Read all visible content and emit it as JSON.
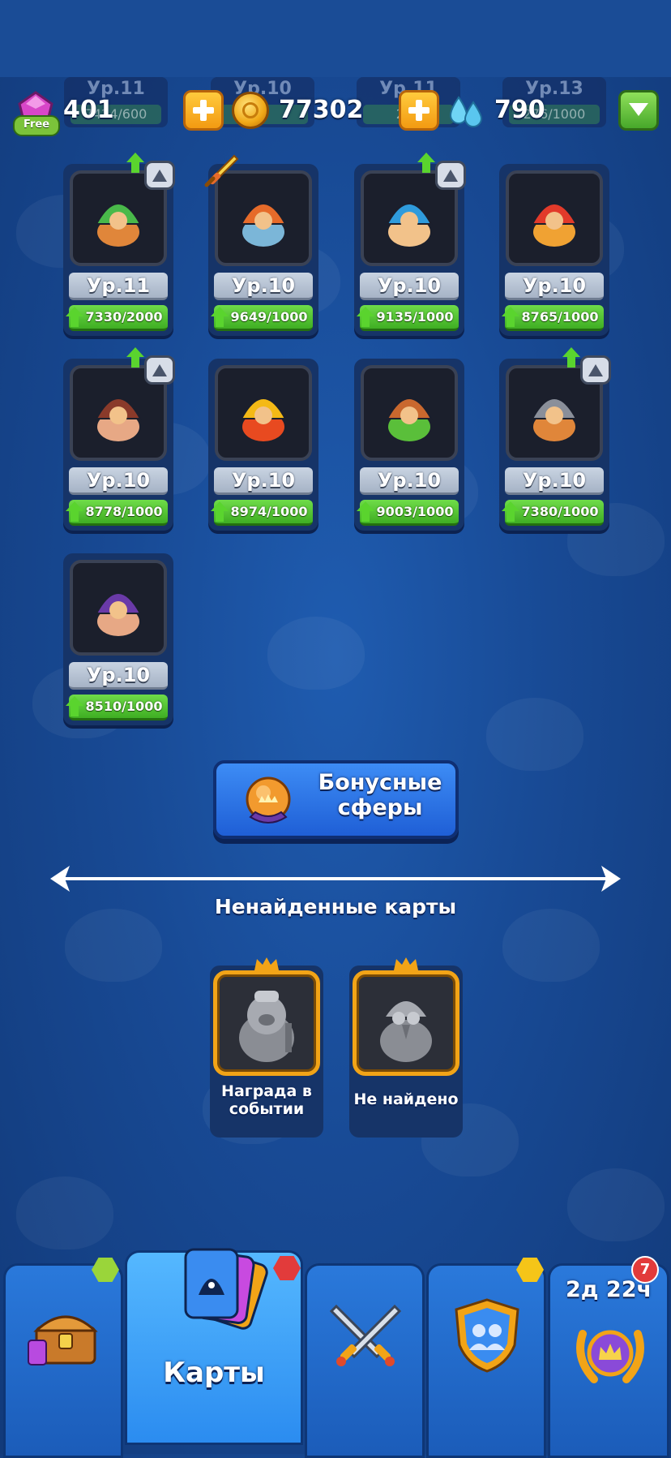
{
  "header": {
    "gems": "401",
    "free_label": "Free",
    "coins": "77302",
    "drops": "790"
  },
  "ghost_row": [
    {
      "level": "Ур.11",
      "progress": "7424/600"
    },
    {
      "level": "Ур.10",
      "progress": ""
    },
    {
      "level": "Ур.11",
      "progress": "293"
    },
    {
      "level": "Ур.13",
      "progress": "276/1000"
    }
  ],
  "cards": [
    {
      "name": "hooded-hero",
      "level": "Ур.11",
      "progress": "7330/2000",
      "upgrade": true,
      "sword": false,
      "colors": [
        "#49b94a",
        "#e0863a"
      ]
    },
    {
      "name": "gasmask-hero",
      "level": "Ур.10",
      "progress": "9649/1000",
      "upgrade": false,
      "sword": true,
      "colors": [
        "#e66b2a",
        "#7bb6d8"
      ]
    },
    {
      "name": "ice-wizard",
      "level": "Ур.10",
      "progress": "9135/1000",
      "upgrade": true,
      "sword": false,
      "colors": [
        "#2f9bdc",
        "#f2c28a"
      ]
    },
    {
      "name": "fire-mage",
      "level": "Ур.10",
      "progress": "8765/1000",
      "upgrade": false,
      "sword": false,
      "colors": [
        "#e23a2a",
        "#f0a233"
      ]
    },
    {
      "name": "boar-gunner",
      "level": "Ур.10",
      "progress": "8778/1000",
      "upgrade": true,
      "sword": false,
      "colors": [
        "#8a3a2a",
        "#e7a885"
      ]
    },
    {
      "name": "lightning-wizard",
      "level": "Ур.10",
      "progress": "8974/1000",
      "upgrade": false,
      "sword": false,
      "colors": [
        "#f4b916",
        "#e84a20"
      ]
    },
    {
      "name": "cannon-dwarf",
      "level": "Ур.10",
      "progress": "9003/1000",
      "upgrade": false,
      "sword": false,
      "colors": [
        "#c9682e",
        "#5abf3a"
      ]
    },
    {
      "name": "armored-warrior",
      "level": "Ур.10",
      "progress": "7380/1000",
      "upgrade": true,
      "sword": false,
      "colors": [
        "#8a8f9a",
        "#e0863a"
      ]
    },
    {
      "name": "bearded-brawler",
      "level": "Ур.10",
      "progress": "8510/1000",
      "upgrade": false,
      "sword": false,
      "colors": [
        "#6a3aa8",
        "#e7a885"
      ]
    }
  ],
  "bonus_button": {
    "label_line1": "Бонусные",
    "label_line2": "сферы"
  },
  "section_title": "Ненайденные карты",
  "locked_cards": [
    {
      "label_line1": "Награда в",
      "label_line2": "событии"
    },
    {
      "label_line1": "Не найдено",
      "label_line2": ""
    }
  ],
  "nav": {
    "shop_label": "",
    "cards_label": "Карты",
    "battle_label": "",
    "clan_label": "",
    "event_timer": "2д 22ч",
    "event_badge": "7"
  },
  "colors": {
    "accent_green": "#5ad42e",
    "gold": "#f2a417",
    "background": "#184a95",
    "badge_yellow": "#f5c518",
    "badge_green": "#9ad53a",
    "badge_red": "#e23b3b"
  }
}
